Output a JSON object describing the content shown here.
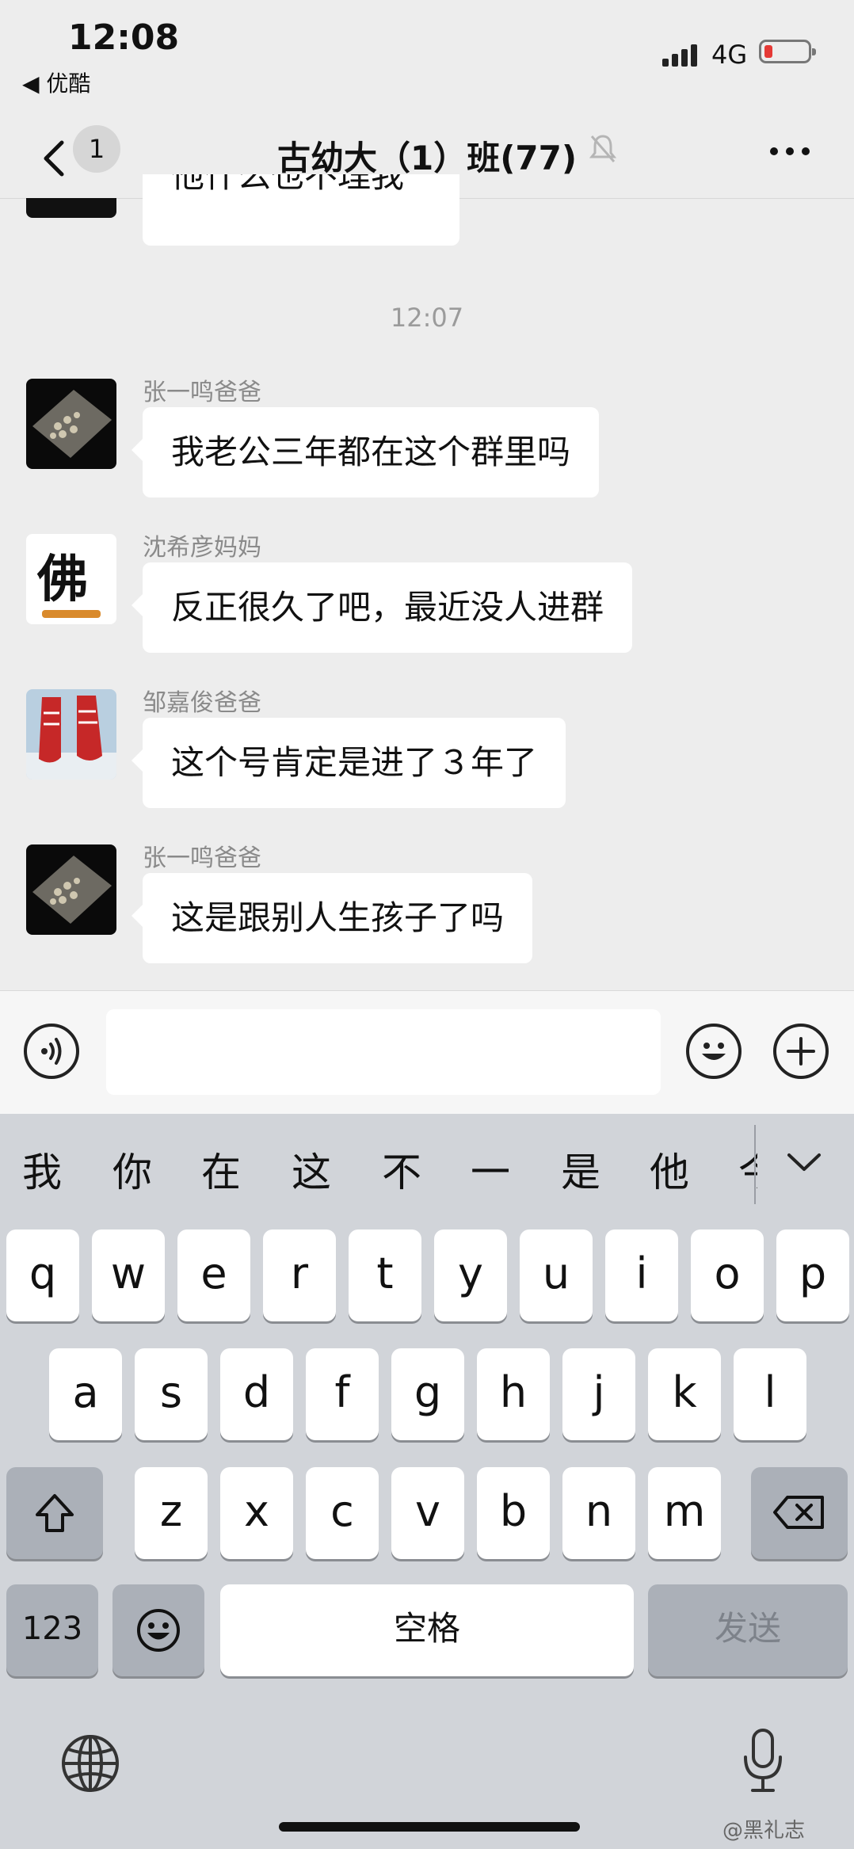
{
  "status_bar": {
    "time": "12:08",
    "back_app": "◀ 优酷",
    "network": "4G"
  },
  "nav": {
    "badge": "1",
    "title": "古幼大（1）班(77)"
  },
  "chat": {
    "partial_message": "他什么也不理我",
    "timestamp": "12:07",
    "messages": [
      {
        "sender": "张一鸣爸爸",
        "text": "我老公三年都在这个群里吗"
      },
      {
        "sender": "沈希彦妈妈",
        "text": "反正很久了吧，最近没人进群",
        "avatar_char": "佛"
      },
      {
        "sender": "邹嘉俊爸爸",
        "text": "这个号肯定是进了３年了"
      },
      {
        "sender": "张一鸣爸爸",
        "text": "这是跟别人生孩子了吗"
      }
    ]
  },
  "keyboard": {
    "candidates": [
      "我",
      "你",
      "在",
      "这",
      "不",
      "一",
      "是",
      "他",
      "今"
    ],
    "row1": [
      "q",
      "w",
      "e",
      "r",
      "t",
      "y",
      "u",
      "i",
      "o",
      "p"
    ],
    "row2": [
      "a",
      "s",
      "d",
      "f",
      "g",
      "h",
      "j",
      "k",
      "l"
    ],
    "row3": [
      "z",
      "x",
      "c",
      "v",
      "b",
      "n",
      "m"
    ],
    "num_label": "123",
    "space_label": "空格",
    "send_label": "发送"
  },
  "watermark": "@黑礼志"
}
